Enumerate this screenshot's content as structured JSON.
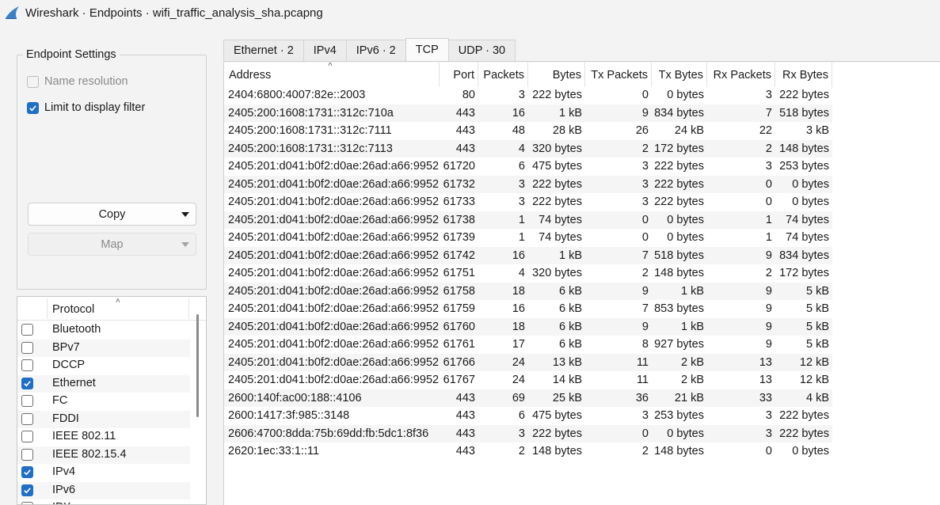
{
  "window": {
    "title": "Wireshark · Endpoints · wifi_traffic_analysis_sha.pcapng",
    "icon": "wireshark-fin-icon"
  },
  "settings": {
    "legend": "Endpoint Settings",
    "name_resolution": {
      "label": "Name resolution",
      "checked": false,
      "enabled": false
    },
    "limit_filter": {
      "label": "Limit to display filter",
      "checked": true,
      "enabled": true
    },
    "copy_label": "Copy",
    "map_label": "Map"
  },
  "protocols": {
    "header": "Protocol",
    "items": [
      {
        "label": "Bluetooth",
        "checked": false
      },
      {
        "label": "BPv7",
        "checked": false
      },
      {
        "label": "DCCP",
        "checked": false
      },
      {
        "label": "Ethernet",
        "checked": true
      },
      {
        "label": "FC",
        "checked": false
      },
      {
        "label": "FDDI",
        "checked": false
      },
      {
        "label": "IEEE 802.11",
        "checked": false
      },
      {
        "label": "IEEE 802.15.4",
        "checked": false
      },
      {
        "label": "IPv4",
        "checked": true
      },
      {
        "label": "IPv6",
        "checked": true
      },
      {
        "label": "IPX",
        "checked": false
      }
    ]
  },
  "tabs": [
    {
      "label": "Ethernet · 2",
      "active": false
    },
    {
      "label": "IPv4",
      "active": false
    },
    {
      "label": "IPv6 · 2",
      "active": false
    },
    {
      "label": "TCP",
      "active": true
    },
    {
      "label": "UDP · 30",
      "active": false
    }
  ],
  "table": {
    "columns": [
      "Address",
      "Port",
      "Packets",
      "Bytes",
      "Tx Packets",
      "Tx Bytes",
      "Rx Packets",
      "Rx Bytes"
    ],
    "rows": [
      [
        "2404:6800:4007:82e::2003",
        "80",
        "3",
        "222 bytes",
        "0",
        "0 bytes",
        "3",
        "222 bytes"
      ],
      [
        "2405:200:1608:1731::312c:710a",
        "443",
        "16",
        "1 kB",
        "9",
        "834 bytes",
        "7",
        "518 bytes"
      ],
      [
        "2405:200:1608:1731::312c:7111",
        "443",
        "48",
        "28 kB",
        "26",
        "24 kB",
        "22",
        "3 kB"
      ],
      [
        "2405:200:1608:1731::312c:7113",
        "443",
        "4",
        "320 bytes",
        "2",
        "172 bytes",
        "2",
        "148 bytes"
      ],
      [
        "2405:201:d041:b0f2:d0ae:26ad:a66:9952",
        "61720",
        "6",
        "475 bytes",
        "3",
        "222 bytes",
        "3",
        "253 bytes"
      ],
      [
        "2405:201:d041:b0f2:d0ae:26ad:a66:9952",
        "61732",
        "3",
        "222 bytes",
        "3",
        "222 bytes",
        "0",
        "0 bytes"
      ],
      [
        "2405:201:d041:b0f2:d0ae:26ad:a66:9952",
        "61733",
        "3",
        "222 bytes",
        "3",
        "222 bytes",
        "0",
        "0 bytes"
      ],
      [
        "2405:201:d041:b0f2:d0ae:26ad:a66:9952",
        "61738",
        "1",
        "74 bytes",
        "0",
        "0 bytes",
        "1",
        "74 bytes"
      ],
      [
        "2405:201:d041:b0f2:d0ae:26ad:a66:9952",
        "61739",
        "1",
        "74 bytes",
        "0",
        "0 bytes",
        "1",
        "74 bytes"
      ],
      [
        "2405:201:d041:b0f2:d0ae:26ad:a66:9952",
        "61742",
        "16",
        "1 kB",
        "7",
        "518 bytes",
        "9",
        "834 bytes"
      ],
      [
        "2405:201:d041:b0f2:d0ae:26ad:a66:9952",
        "61751",
        "4",
        "320 bytes",
        "2",
        "148 bytes",
        "2",
        "172 bytes"
      ],
      [
        "2405:201:d041:b0f2:d0ae:26ad:a66:9952",
        "61758",
        "18",
        "6 kB",
        "9",
        "1 kB",
        "9",
        "5 kB"
      ],
      [
        "2405:201:d041:b0f2:d0ae:26ad:a66:9952",
        "61759",
        "16",
        "6 kB",
        "7",
        "853 bytes",
        "9",
        "5 kB"
      ],
      [
        "2405:201:d041:b0f2:d0ae:26ad:a66:9952",
        "61760",
        "18",
        "6 kB",
        "9",
        "1 kB",
        "9",
        "5 kB"
      ],
      [
        "2405:201:d041:b0f2:d0ae:26ad:a66:9952",
        "61761",
        "17",
        "6 kB",
        "8",
        "927 bytes",
        "9",
        "5 kB"
      ],
      [
        "2405:201:d041:b0f2:d0ae:26ad:a66:9952",
        "61766",
        "24",
        "13 kB",
        "11",
        "2 kB",
        "13",
        "12 kB"
      ],
      [
        "2405:201:d041:b0f2:d0ae:26ad:a66:9952",
        "61767",
        "24",
        "14 kB",
        "11",
        "2 kB",
        "13",
        "12 kB"
      ],
      [
        "2600:140f:ac00:188::4106",
        "443",
        "69",
        "25 kB",
        "36",
        "21 kB",
        "33",
        "4 kB"
      ],
      [
        "2600:1417:3f:985::3148",
        "443",
        "6",
        "475 bytes",
        "3",
        "253 bytes",
        "3",
        "222 bytes"
      ],
      [
        "2606:4700:8dda:75b:69dd:fb:5dc1:8f36",
        "443",
        "3",
        "222 bytes",
        "0",
        "0 bytes",
        "3",
        "222 bytes"
      ],
      [
        "2620:1ec:33:1::11",
        "443",
        "2",
        "148 bytes",
        "2",
        "148 bytes",
        "0",
        "0 bytes"
      ]
    ]
  },
  "colors": {
    "accent": "#1f6fc6",
    "alt_row": "#f5f5f5"
  }
}
